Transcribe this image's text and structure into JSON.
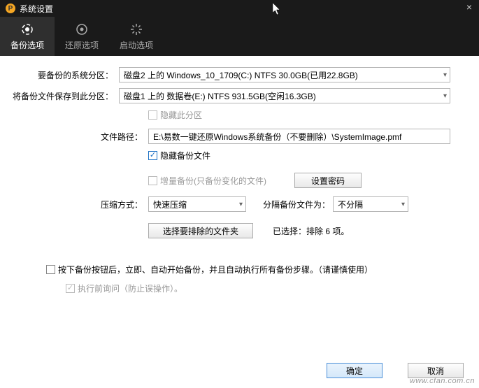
{
  "window": {
    "title": "系统设置",
    "badge": "P"
  },
  "tabs": {
    "backup": "备份选项",
    "restore": "还原选项",
    "startup": "启动选项"
  },
  "labels": {
    "systemPartition": "要备份的系统分区：",
    "savePartition": "将备份文件保存到此分区：",
    "filePath": "文件路径：",
    "compressMode": "压缩方式：",
    "splitLabel": "分隔备份文件为："
  },
  "values": {
    "systemPartition": "磁盘2 上的 Windows_10_1709(C:) NTFS 30.0GB(已用22.8GB)",
    "savePartition": "磁盘1 上的 数据卷(E:) NTFS 931.5GB(空闲16.3GB)",
    "filePath": "E:\\易数一键还原Windows系统备份（不要删除）\\SystemImage.pmf",
    "compressMode": "快速压缩",
    "splitMode": "不分隔"
  },
  "checkboxes": {
    "hidePartition": "隐藏此分区",
    "hideBackupFile": "隐藏备份文件",
    "incremental": "增量备份(只备份变化的文件)",
    "autoStart": "按下备份按钮后，立即、自动开始备份，并且自动执行所有备份步骤。（请谨慎使用）",
    "confirmBefore": "执行前询问（防止误操作）。"
  },
  "buttons": {
    "setPassword": "设置密码",
    "excludeFolders": "选择要排除的文件夹",
    "ok": "确定",
    "cancel": "取消"
  },
  "excludeStatus": {
    "prefix": "已选择：排除 ",
    "count": "6",
    "suffix": " 项。"
  },
  "watermark": "www.cfan.com.cn"
}
